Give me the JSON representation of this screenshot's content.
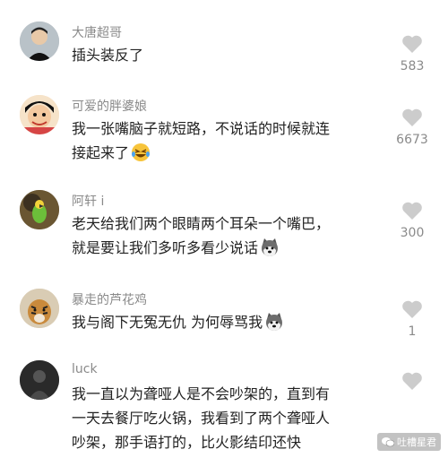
{
  "comments": [
    {
      "username": "大唐超哥",
      "text": "插头装反了",
      "likes": "583",
      "avatar": "man-avatar"
    },
    {
      "username": "可爱的胖婆娘",
      "text": "我一张嘴脑子就短路，不说话的时候就连\n接起来了",
      "likes": "6673",
      "avatar": "cartoon-avatar",
      "emoji": "laughing-tears-emoji"
    },
    {
      "username": "阿轩 i",
      "text": "老天给我们两个眼睛两个耳朵一个嘴巴，\n就是要让我们多听多看少说话",
      "likes": "300",
      "avatar": "parrot-avatar",
      "emoji": "husky-emoji"
    },
    {
      "username": "暴走的芦花鸡",
      "text": "我与阁下无冤无仇 为何辱骂我",
      "likes": "1",
      "avatar": "tiger-avatar",
      "emoji": "husky-emoji"
    },
    {
      "username": "luck",
      "text": "我一直以为聋哑人是不会吵架的，直到有\n一天去餐厅吃火锅，我看到了两个聋哑人\n吵架，那手语打的，比火影结印还快",
      "avatar": "dark-avatar"
    }
  ],
  "watermark": "吐槽星君",
  "colors": {
    "text": "#222222",
    "meta": "#8a8a8a",
    "heart": "#cccccc"
  }
}
